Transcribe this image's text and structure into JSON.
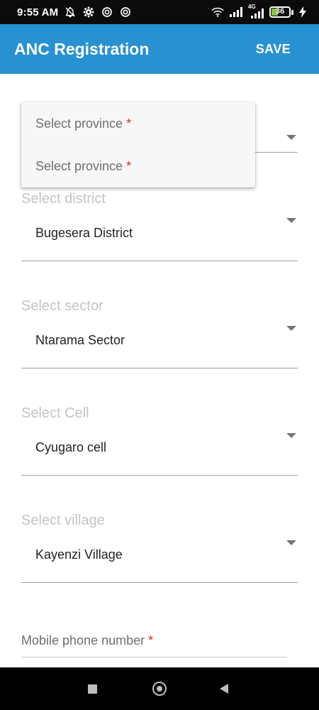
{
  "status_bar": {
    "time": "9:55 AM",
    "left_icons": [
      "notifications-off-icon",
      "gear-icon",
      "sync-icon",
      "sync-icon"
    ],
    "right_icons": [
      "wifi-icon",
      "signal-icon",
      "signal-4g-icon"
    ],
    "network_label": "4G",
    "battery_level": "36"
  },
  "app_bar": {
    "title": "ANC Registration",
    "save_label": "SAVE",
    "color": "#2791d2"
  },
  "dropdown": {
    "options": [
      {
        "label": "Select province",
        "required_mark": "*"
      },
      {
        "label": "Select province",
        "required_mark": "*"
      }
    ]
  },
  "form": {
    "fields": [
      {
        "label": "Select district",
        "value": "Bugesera District"
      },
      {
        "label": "Select sector",
        "value": "Ntarama Sector"
      },
      {
        "label": "Select Cell",
        "value": "Cyugaro cell"
      },
      {
        "label": "Select village",
        "value": "Kayenzi Village"
      }
    ],
    "phone": {
      "label": "Mobile phone number",
      "required_mark": "*"
    }
  }
}
